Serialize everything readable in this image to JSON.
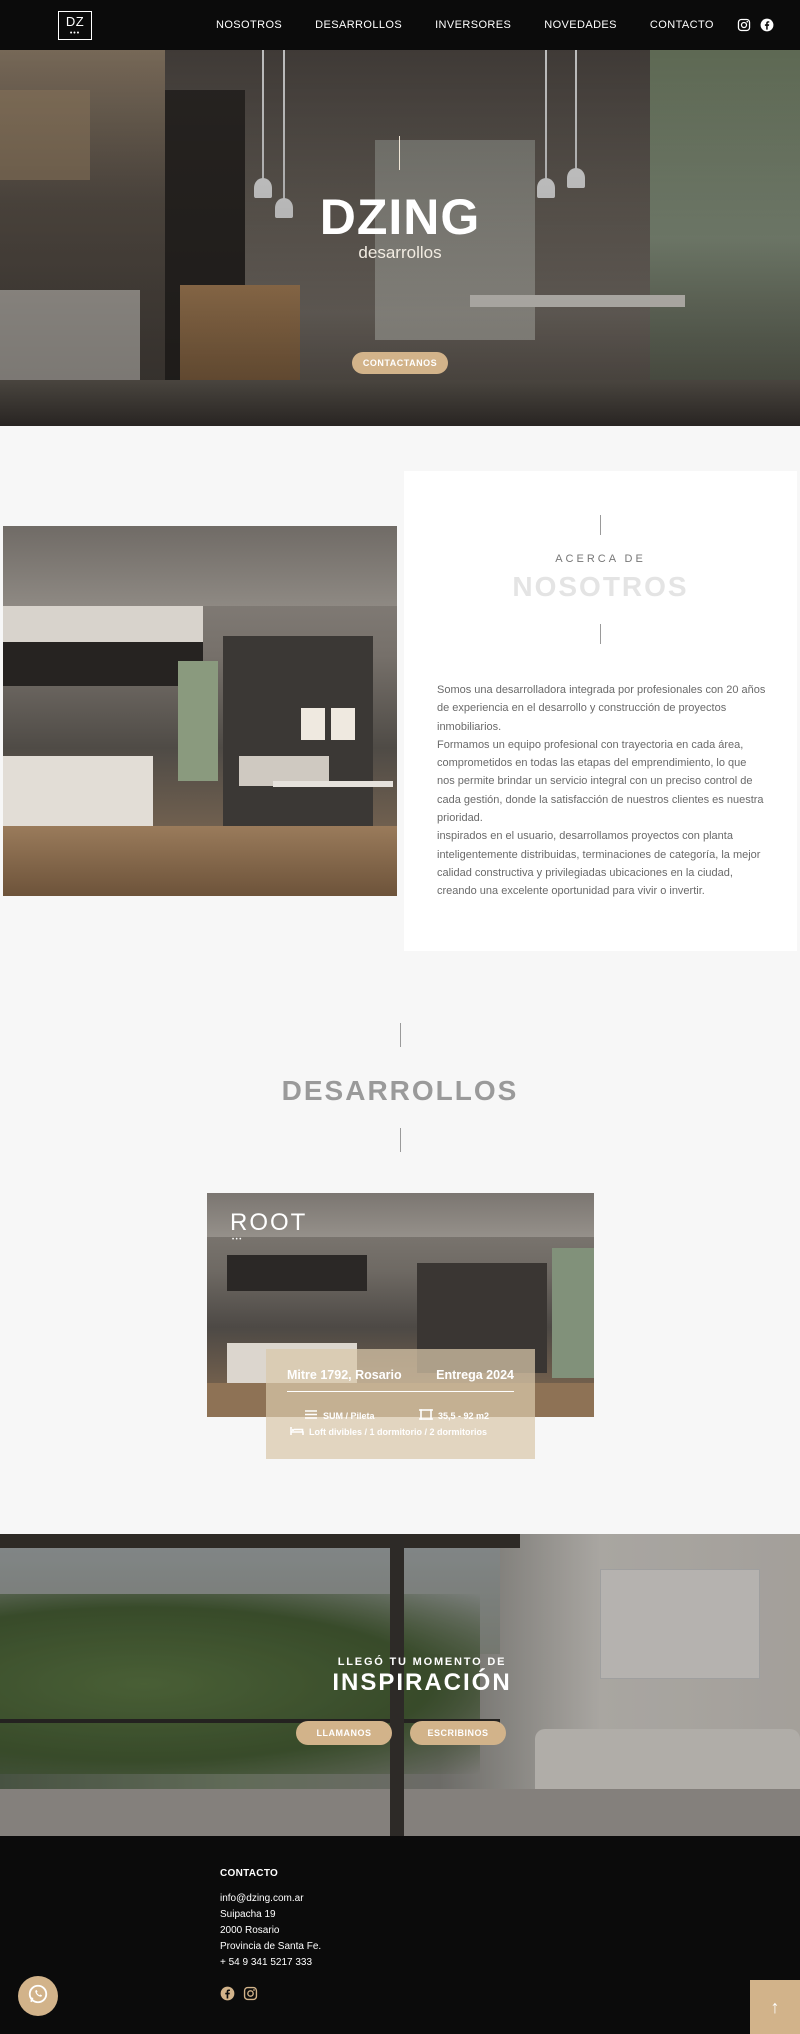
{
  "header": {
    "logo": {
      "text": "DZ",
      "dots": "•••"
    },
    "nav": [
      "NOSOTROS",
      "DESARROLLOS",
      "INVERSORES",
      "NOVEDADES",
      "CONTACTO"
    ],
    "social_icons": [
      "instagram-icon",
      "facebook-icon"
    ]
  },
  "hero": {
    "title": "DZING",
    "subtitle": "desarrollos",
    "cta": "CONTACTANOS"
  },
  "about": {
    "eyebrow": "ACERCA DE",
    "title": "NOSOTROS",
    "paragraphs": [
      "Somos una desarrolladora integrada por profesionales con 20 años de experiencia en el desarrollo y construcción de proyectos inmobiliarios.",
      "Formamos un equipo profesional con trayectoria en cada área, comprometidos en todas las etapas del emprendimiento, lo que nos permite brindar un servicio integral con un preciso control de cada gestión, donde la satisfacción de nuestros clientes es nuestra prioridad.",
      "inspirados en el usuario, desarrollamos proyectos con planta inteligentemente distribuidas, terminaciones de categoría, la mejor calidad constructiva y privilegiadas ubicaciones en la ciudad, creando una excelente oportunidad para vivir o invertir."
    ]
  },
  "developments": {
    "title": "DESARROLLOS",
    "project": {
      "name": "ROOT",
      "dots": "•••",
      "address": "Mitre 1792, Rosario",
      "delivery": "Entrega 2024",
      "amenities": "SUM / Pileta",
      "size": "35,5 - 92 m2",
      "units": "Loft divibles / 1 dormitorio / 2 dormitorios"
    }
  },
  "inspiration": {
    "eyebrow": "LLEGÓ TU MOMENTO DE",
    "title": "INSPIRACIÓN",
    "call": "LLAMANOS",
    "write": "ESCRIBINOS"
  },
  "footer": {
    "title": "CONTACTO",
    "lines": [
      "info@dzing.com.ar",
      "Suipacha 19",
      "2000 Rosario",
      "Provincia de Santa Fe.",
      "+ 54 9 341 5217 333"
    ],
    "social_icons": [
      "facebook-icon",
      "instagram-icon"
    ],
    "whatsapp_icon": "whatsapp-icon",
    "scroll_top": "↑"
  },
  "colors": {
    "accent": "#d2b38a",
    "header_bg": "#0b0b0b",
    "page_bg": "#f7f7f7"
  }
}
